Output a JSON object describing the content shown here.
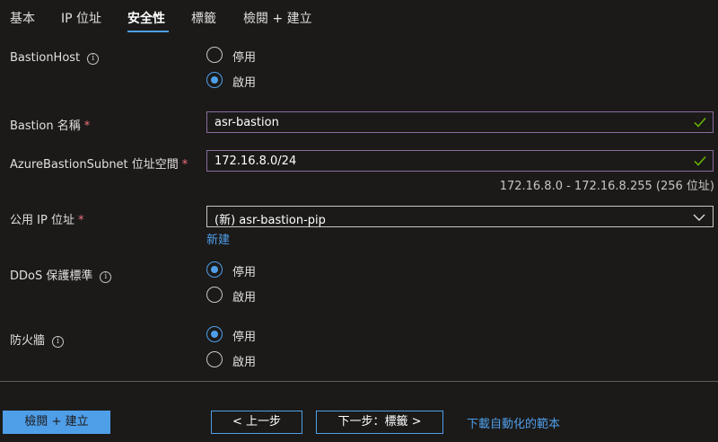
{
  "tabs": [
    {
      "label": "基本"
    },
    {
      "label": "IP 位址"
    },
    {
      "label": "安全性",
      "active": true
    },
    {
      "label": "標籤"
    },
    {
      "label": "檢閱 + 建立"
    }
  ],
  "bastion_host": {
    "label": "BastionHost",
    "options": [
      "停用",
      "啟用"
    ],
    "selected": "啟用"
  },
  "bastion_name": {
    "label": "Bastion 名稱",
    "required_mark": "*",
    "value": "asr-bastion"
  },
  "bastion_subnet": {
    "label": "AzureBastionSubnet 位址空間",
    "required_mark": "*",
    "value": "172.16.8.0/24",
    "hint": "172.16.8.0 - 172.16.8.255 (256 位址)"
  },
  "public_ip": {
    "label": "公用 IP 位址",
    "required_mark": "*",
    "value": "(新) asr-bastion-pip",
    "create_link": "新建"
  },
  "ddos": {
    "label": "DDoS 保護標準",
    "options": [
      "停用",
      "啟用"
    ],
    "selected": "停用"
  },
  "firewall": {
    "label": "防火牆",
    "options": [
      "停用",
      "啟用"
    ],
    "selected": "停用"
  },
  "footer": {
    "review_create": "檢閱 + 建立",
    "previous": "< 上一步",
    "next": "下一步：標籤 >",
    "download_template": "下載自動化的範本"
  },
  "colors": {
    "background": "#1b1a19",
    "accent": "#4f9ee8",
    "valid_check": "#6bb700",
    "required": "#f1707b"
  }
}
